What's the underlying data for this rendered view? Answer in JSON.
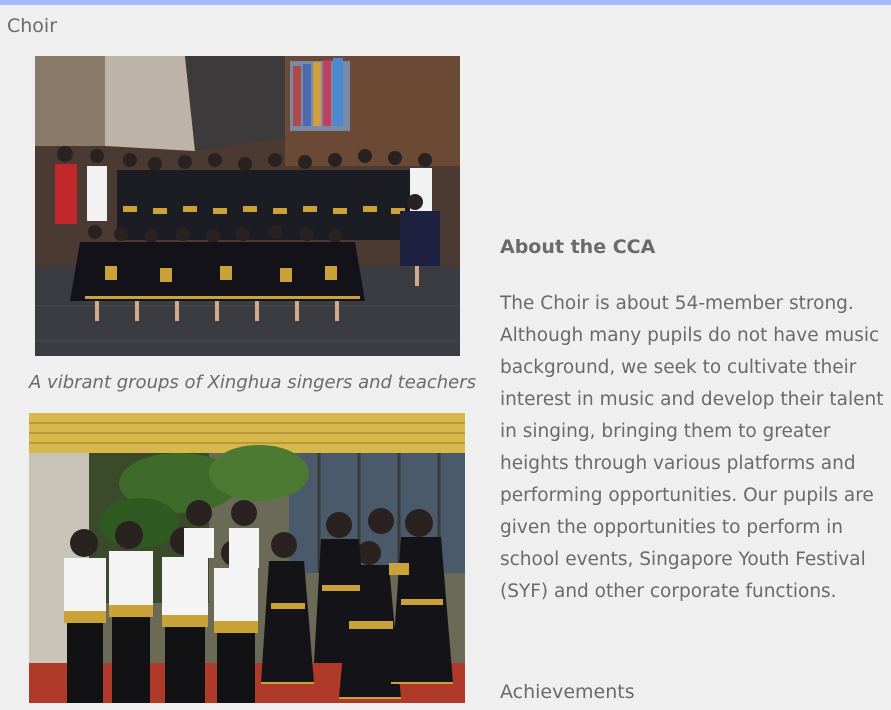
{
  "section": {
    "title": "Choir"
  },
  "photos": [
    {
      "name": "choir-group-photo",
      "caption": "A vibrant groups of Xinghua singers and teachers"
    },
    {
      "name": "choir-small-group-photo"
    }
  ],
  "about": {
    "heading": "About the CCA",
    "body": "The Choir is about 54-member strong. Although many pupils do not have music background, we seek to cultivate their interest in music and develop their talent in singing, bringing them to greater heights through various platforms and performing opportunities. Our pupils are given the opportunities to perform in school events, Singapore Youth Festival (SYF) and other corporate functions."
  },
  "achievements": {
    "heading": "Achievements"
  },
  "colors": {
    "accent_bar": "#a9b7ff",
    "background": "#efefef",
    "text": "#6a6a6a",
    "uniform_gold": "#c9a338"
  }
}
